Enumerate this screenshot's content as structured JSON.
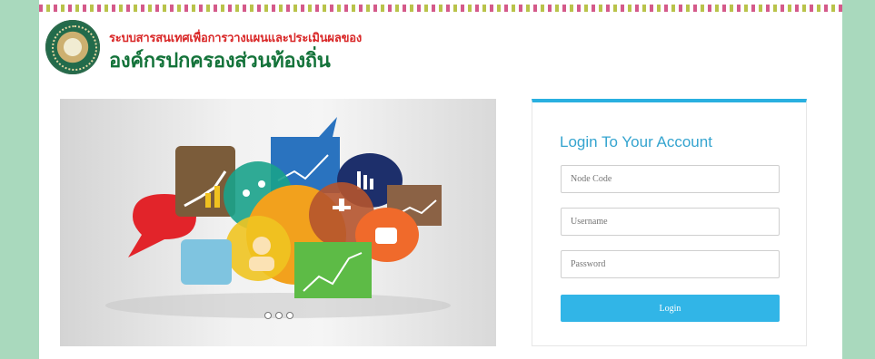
{
  "header": {
    "subtitle": "ระบบสารสนเทศเพื่อการวางแผนและประเมินผลของ",
    "title": "องค์กรปกครองส่วนท้องถิ่น"
  },
  "login": {
    "heading": "Login To Your Account",
    "node_code_placeholder": "Node Code",
    "username_placeholder": "Username",
    "password_placeholder": "Password",
    "button_label": "Login"
  },
  "colors": {
    "accent": "#31b5e7",
    "header_red": "#d92828",
    "header_green": "#14733a",
    "side_green": "#a9d9bd"
  }
}
